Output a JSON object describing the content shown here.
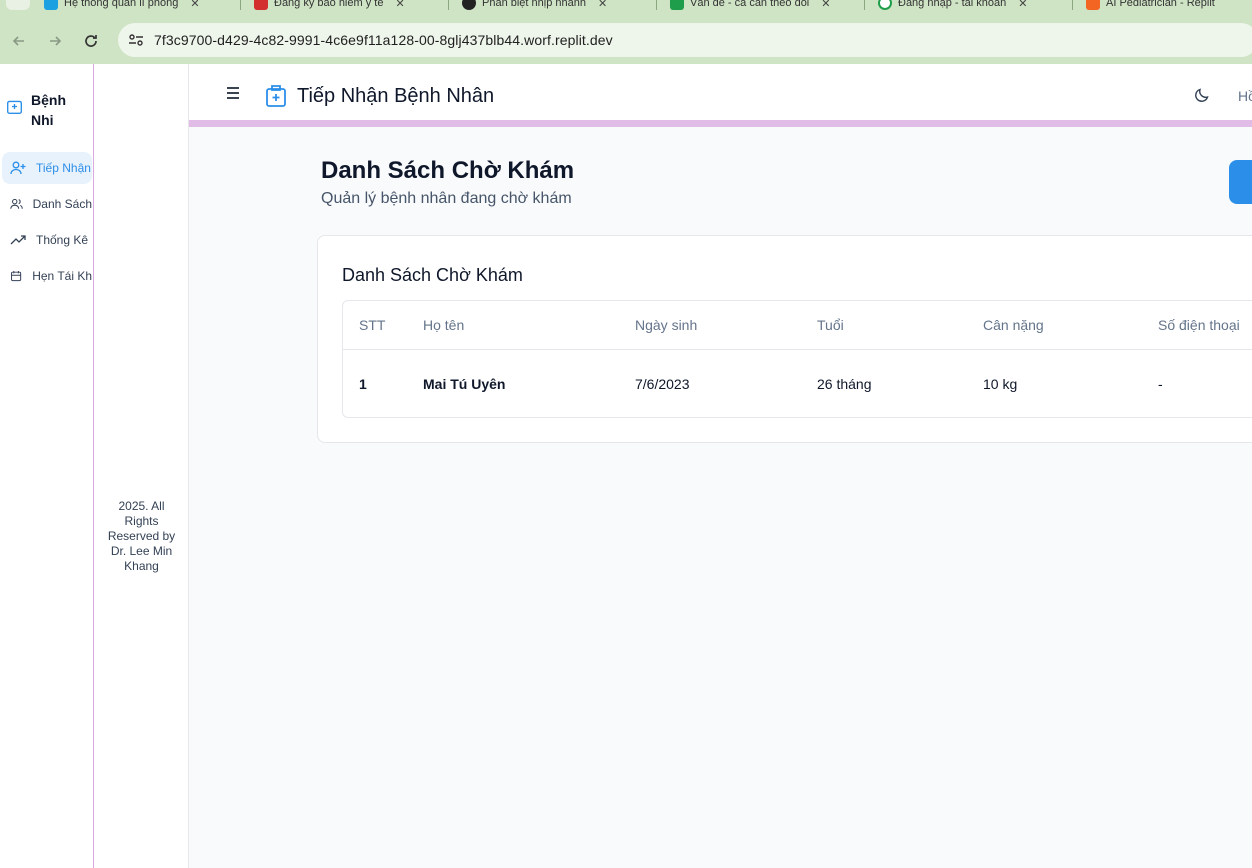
{
  "browser": {
    "tabs": [
      {
        "label": "Hệ thống quản lí phòng",
        "favicon_color": "#1ba1e2"
      },
      {
        "label": "Đăng ký bảo hiểm y tế",
        "favicon_color": "#d32f2f"
      },
      {
        "label": "Phân biệt nhịp nhanh",
        "favicon_color": "#222222"
      },
      {
        "label": "Vấn đề - cá cần theo dõi",
        "favicon_color": "#1e9e4a"
      },
      {
        "label": "Đăng nhập - tài khoản",
        "favicon_color": "#1e9e4a"
      },
      {
        "label": "AI Pediatrician - Replit",
        "favicon_color": "#f26522"
      }
    ],
    "url": "7f3c9700-d429-4c82-9991-4c6e9f11a128-00-8glj437blb44.worf.replit.dev"
  },
  "sidebar": {
    "brand": "Bệnh Nhi",
    "items": [
      {
        "label": "Tiếp Nhận",
        "icon": "user-plus-icon",
        "active": true
      },
      {
        "label": "Danh Sách",
        "icon": "users-icon",
        "active": false
      },
      {
        "label": "Thống Kê",
        "icon": "trending-up-icon",
        "active": false
      },
      {
        "label": "Hẹn Tái Kh",
        "icon": "calendar-icon",
        "active": false
      }
    ],
    "footer": "2025. All Rights Reserved by Dr. Lee Min Khang"
  },
  "header": {
    "title": "Tiếp Nhận Bệnh Nhân",
    "right_link": "Hồ"
  },
  "main": {
    "title": "Danh Sách Chờ Khám",
    "subtitle": "Quản lý bệnh nhân đang chờ khám",
    "card_title": "Danh Sách Chờ Khám",
    "table": {
      "columns": [
        "STT",
        "Họ tên",
        "Ngày sinh",
        "Tuổi",
        "Cân nặng",
        "Số điện thoại"
      ],
      "rows": [
        [
          "1",
          "Mai Tú Uyên",
          "7/6/2023",
          "26 tháng",
          "10 kg",
          "-"
        ]
      ]
    }
  },
  "colors": {
    "accent": "#2b8ee8",
    "header_stripe": "#e0bce7"
  }
}
